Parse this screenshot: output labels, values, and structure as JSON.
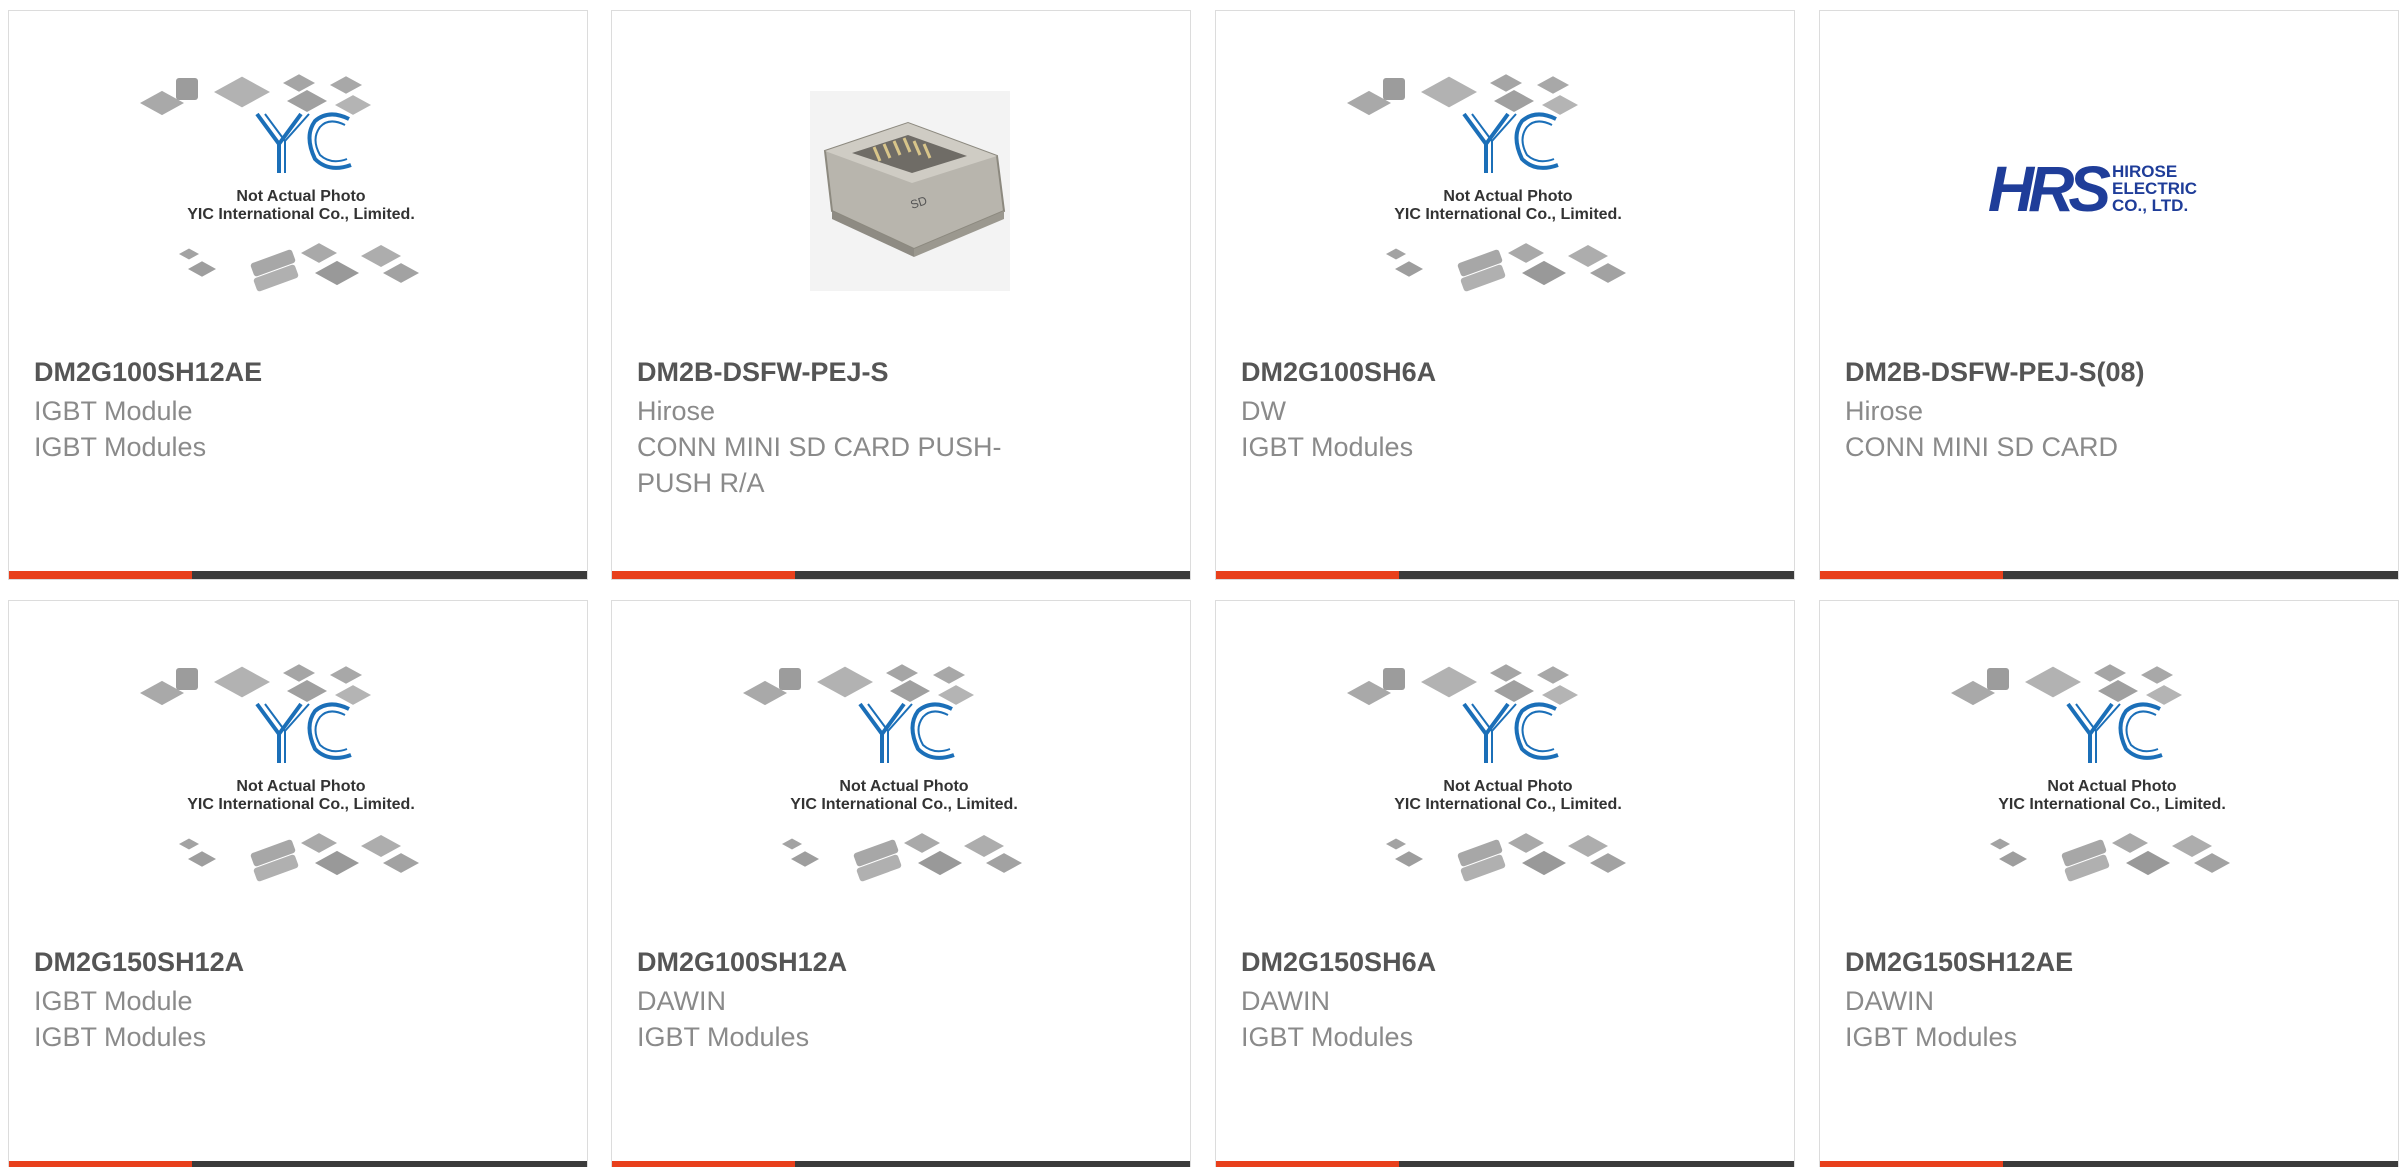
{
  "placeholder_image": {
    "line1": "Not Actual Photo",
    "line2": "YIC International Co., Limited.",
    "logo_text": "YIC",
    "logo_color": "#1b6fb8"
  },
  "hirose_logo": {
    "mark": "HRS",
    "line1": "HIROSE",
    "line2": "ELECTRIC",
    "line3": "CO., LTD.",
    "color": "#1f3d99"
  },
  "colors": {
    "accent": "#e8401c",
    "bar": "#3b3b3b",
    "title": "#555555",
    "text": "#8a8a8a"
  },
  "products": [
    {
      "part": "DM2G100SH12AE",
      "manufacturer": "IGBT Module",
      "description": "IGBT Modules",
      "image": "yic-placeholder"
    },
    {
      "part": "DM2B-DSFW-PEJ-S",
      "manufacturer": "Hirose",
      "description": "CONN MINI SD CARD PUSH-PUSH R/A",
      "image": "sd-card-connector-photo"
    },
    {
      "part": "DM2G100SH6A",
      "manufacturer": "DW",
      "description": "IGBT Modules",
      "image": "yic-placeholder"
    },
    {
      "part": "DM2B-DSFW-PEJ-S(08)",
      "manufacturer": "Hirose",
      "description": "CONN MINI SD CARD",
      "image": "hirose-logo"
    },
    {
      "part": "DM2G150SH12A",
      "manufacturer": "IGBT Module",
      "description": "IGBT Modules",
      "image": "yic-placeholder"
    },
    {
      "part": "DM2G100SH12A",
      "manufacturer": "DAWIN",
      "description": "IGBT Modules",
      "image": "yic-placeholder"
    },
    {
      "part": "DM2G150SH6A",
      "manufacturer": "DAWIN",
      "description": "IGBT Modules",
      "image": "yic-placeholder"
    },
    {
      "part": "DM2G150SH12AE",
      "manufacturer": "DAWIN",
      "description": "IGBT Modules",
      "image": "yic-placeholder"
    }
  ]
}
